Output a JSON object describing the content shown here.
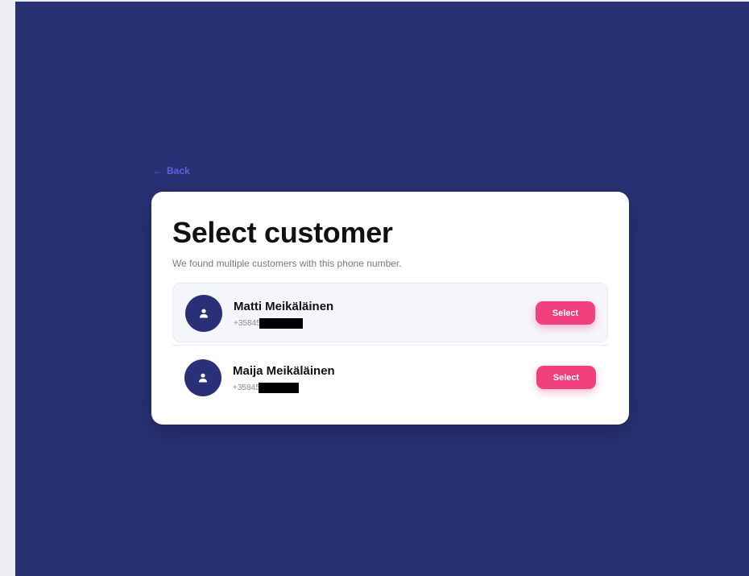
{
  "back": {
    "label": "Back"
  },
  "page": {
    "title": "Select customer",
    "subtitle": "We found multiple customers with this phone number."
  },
  "customers": [
    {
      "name": "Matti Meikäläinen",
      "phone_prefix": "+35845",
      "phone_redacted": true,
      "action_label": "Select"
    },
    {
      "name": "Maija Meikäläinen",
      "phone_prefix": "+35845",
      "phone_redacted": true,
      "action_label": "Select"
    }
  ],
  "colors": {
    "background": "#283174",
    "card": "#ffffff",
    "accent": "#f23f7d",
    "avatar": "#2a3077",
    "back_link": "#5d62e6",
    "outer": "#eceef2"
  },
  "icons": {
    "back": "arrow-left-icon",
    "avatar": "person-icon"
  }
}
